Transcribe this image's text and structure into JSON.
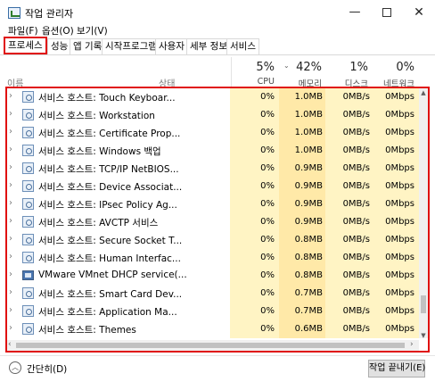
{
  "window": {
    "title": "작업 관리자",
    "minimize_symbol": "—",
    "close_symbol": "✕"
  },
  "menu": [
    "파일(F)",
    "옵션(O)",
    "보기(V)"
  ],
  "tabs": [
    "프로세스",
    "성능",
    "앱 기록",
    "시작프로그램",
    "사용자",
    "세부 정보",
    "서비스"
  ],
  "active_tab": "프로세스",
  "columns": {
    "name": "이름",
    "status": "상태",
    "cpu": {
      "pct": "5%",
      "label": "CPU"
    },
    "memory": {
      "pct": "42%",
      "label": "메모리"
    },
    "disk": {
      "pct": "1%",
      "label": "디스크"
    },
    "network": {
      "pct": "0%",
      "label": "네트워크"
    }
  },
  "sort_indicator": "⌄",
  "processes": [
    {
      "name": "서비스 호스트: Touch Keyboar...",
      "cpu": "0%",
      "memory": "1.0MB",
      "disk": "0MB/s",
      "network": "0Mbps",
      "icon": "gear-icon"
    },
    {
      "name": "서비스 호스트: Workstation",
      "cpu": "0%",
      "memory": "1.0MB",
      "disk": "0MB/s",
      "network": "0Mbps",
      "icon": "gear-icon"
    },
    {
      "name": "서비스 호스트: Certificate Prop...",
      "cpu": "0%",
      "memory": "1.0MB",
      "disk": "0MB/s",
      "network": "0Mbps",
      "icon": "gear-icon"
    },
    {
      "name": "서비스 호스트: Windows 백업",
      "cpu": "0%",
      "memory": "1.0MB",
      "disk": "0MB/s",
      "network": "0Mbps",
      "icon": "gear-icon"
    },
    {
      "name": "서비스 호스트: TCP/IP NetBIOS...",
      "cpu": "0%",
      "memory": "0.9MB",
      "disk": "0MB/s",
      "network": "0Mbps",
      "icon": "gear-icon"
    },
    {
      "name": "서비스 호스트: Device Associat...",
      "cpu": "0%",
      "memory": "0.9MB",
      "disk": "0MB/s",
      "network": "0Mbps",
      "icon": "gear-icon"
    },
    {
      "name": "서비스 호스트: IPsec Policy Ag...",
      "cpu": "0%",
      "memory": "0.9MB",
      "disk": "0MB/s",
      "network": "0Mbps",
      "icon": "gear-icon"
    },
    {
      "name": "서비스 호스트: AVCTP 서비스",
      "cpu": "0%",
      "memory": "0.9MB",
      "disk": "0MB/s",
      "network": "0Mbps",
      "icon": "gear-icon"
    },
    {
      "name": "서비스 호스트: Secure Socket T...",
      "cpu": "0%",
      "memory": "0.8MB",
      "disk": "0MB/s",
      "network": "0Mbps",
      "icon": "gear-icon"
    },
    {
      "name": "서비스 호스트: Human Interfac...",
      "cpu": "0%",
      "memory": "0.8MB",
      "disk": "0MB/s",
      "network": "0Mbps",
      "icon": "gear-icon"
    },
    {
      "name": "VMware VMnet DHCP service(...",
      "cpu": "0%",
      "memory": "0.8MB",
      "disk": "0MB/s",
      "network": "0Mbps",
      "icon": "vmware-icon"
    },
    {
      "name": "서비스 호스트: Smart Card Dev...",
      "cpu": "0%",
      "memory": "0.7MB",
      "disk": "0MB/s",
      "network": "0Mbps",
      "icon": "gear-icon"
    },
    {
      "name": "서비스 호스트: Application Ma...",
      "cpu": "0%",
      "memory": "0.7MB",
      "disk": "0MB/s",
      "network": "0Mbps",
      "icon": "gear-icon"
    },
    {
      "name": "서비스 호스트: Themes",
      "cpu": "0%",
      "memory": "0.6MB",
      "disk": "0MB/s",
      "network": "0Mbps",
      "icon": "gear-icon"
    }
  ],
  "footer": {
    "fewer_details": "간단히(D)",
    "end_task": "작업 끝내기(E)"
  },
  "colors": {
    "highlight_red": "#e01010",
    "cpu_bg": "#fff4c4",
    "memory_bg": "#ffe9a8"
  }
}
